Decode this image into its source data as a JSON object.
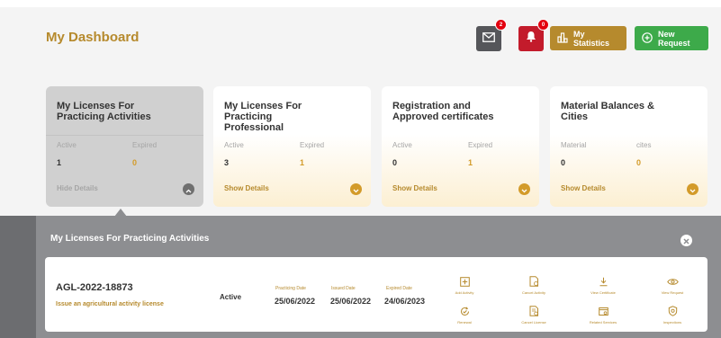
{
  "header": {
    "title": "My Dashboard",
    "mail_badge": "2",
    "bell_badge": "0",
    "stats_label": "My Statistics",
    "new_request_label": "New Request"
  },
  "cards": [
    {
      "title": "My Licenses For Practicing Activities",
      "label_a": "Active",
      "label_b": "Expired",
      "value_a": "1",
      "value_b": "0",
      "action": "Hide Details"
    },
    {
      "title": "My Licenses For Practicing Professional",
      "label_a": "Active",
      "label_b": "Expired",
      "value_a": "3",
      "value_b": "1",
      "action": "Show Details"
    },
    {
      "title": "Registration and Approved certificates",
      "label_a": "Active",
      "label_b": "Expired",
      "value_a": "0",
      "value_b": "1",
      "action": "Show Details"
    },
    {
      "title": "Material Balances & Cities",
      "label_a": "Material",
      "label_b": "cites",
      "value_a": "0",
      "value_b": "0",
      "action": "Show Details"
    }
  ],
  "panel": {
    "title": "My Licenses For Practicing Activities",
    "license": {
      "number": "AGL-2022-18873",
      "description": "Issue an agricultural activity license",
      "status": "Active",
      "practicing_date_label": "Practicing Date",
      "practicing_date": "25/06/2022",
      "issued_date_label": "Issued Date",
      "issued_date": "25/06/2022",
      "expired_date_label": "Expired Date",
      "expired_date": "24/06/2023"
    },
    "actions": [
      {
        "label": "Add Activity",
        "icon": "add-activity-icon"
      },
      {
        "label": "Cancel Activity",
        "icon": "cancel-activity-icon"
      },
      {
        "label": "View Certificate",
        "icon": "download-icon"
      },
      {
        "label": "View Request",
        "icon": "eye-icon"
      },
      {
        "label": "Renewal",
        "icon": "renew-icon"
      },
      {
        "label": "Cancel License",
        "icon": "cancel-license-icon"
      },
      {
        "label": "Related Services",
        "icon": "related-services-icon"
      },
      {
        "label": "Inspections",
        "icon": "inspections-icon"
      }
    ]
  },
  "colors": {
    "gold": "#b68a2d",
    "green": "#3daa4a",
    "red": "#c31b2b",
    "dark": "#55565a"
  }
}
